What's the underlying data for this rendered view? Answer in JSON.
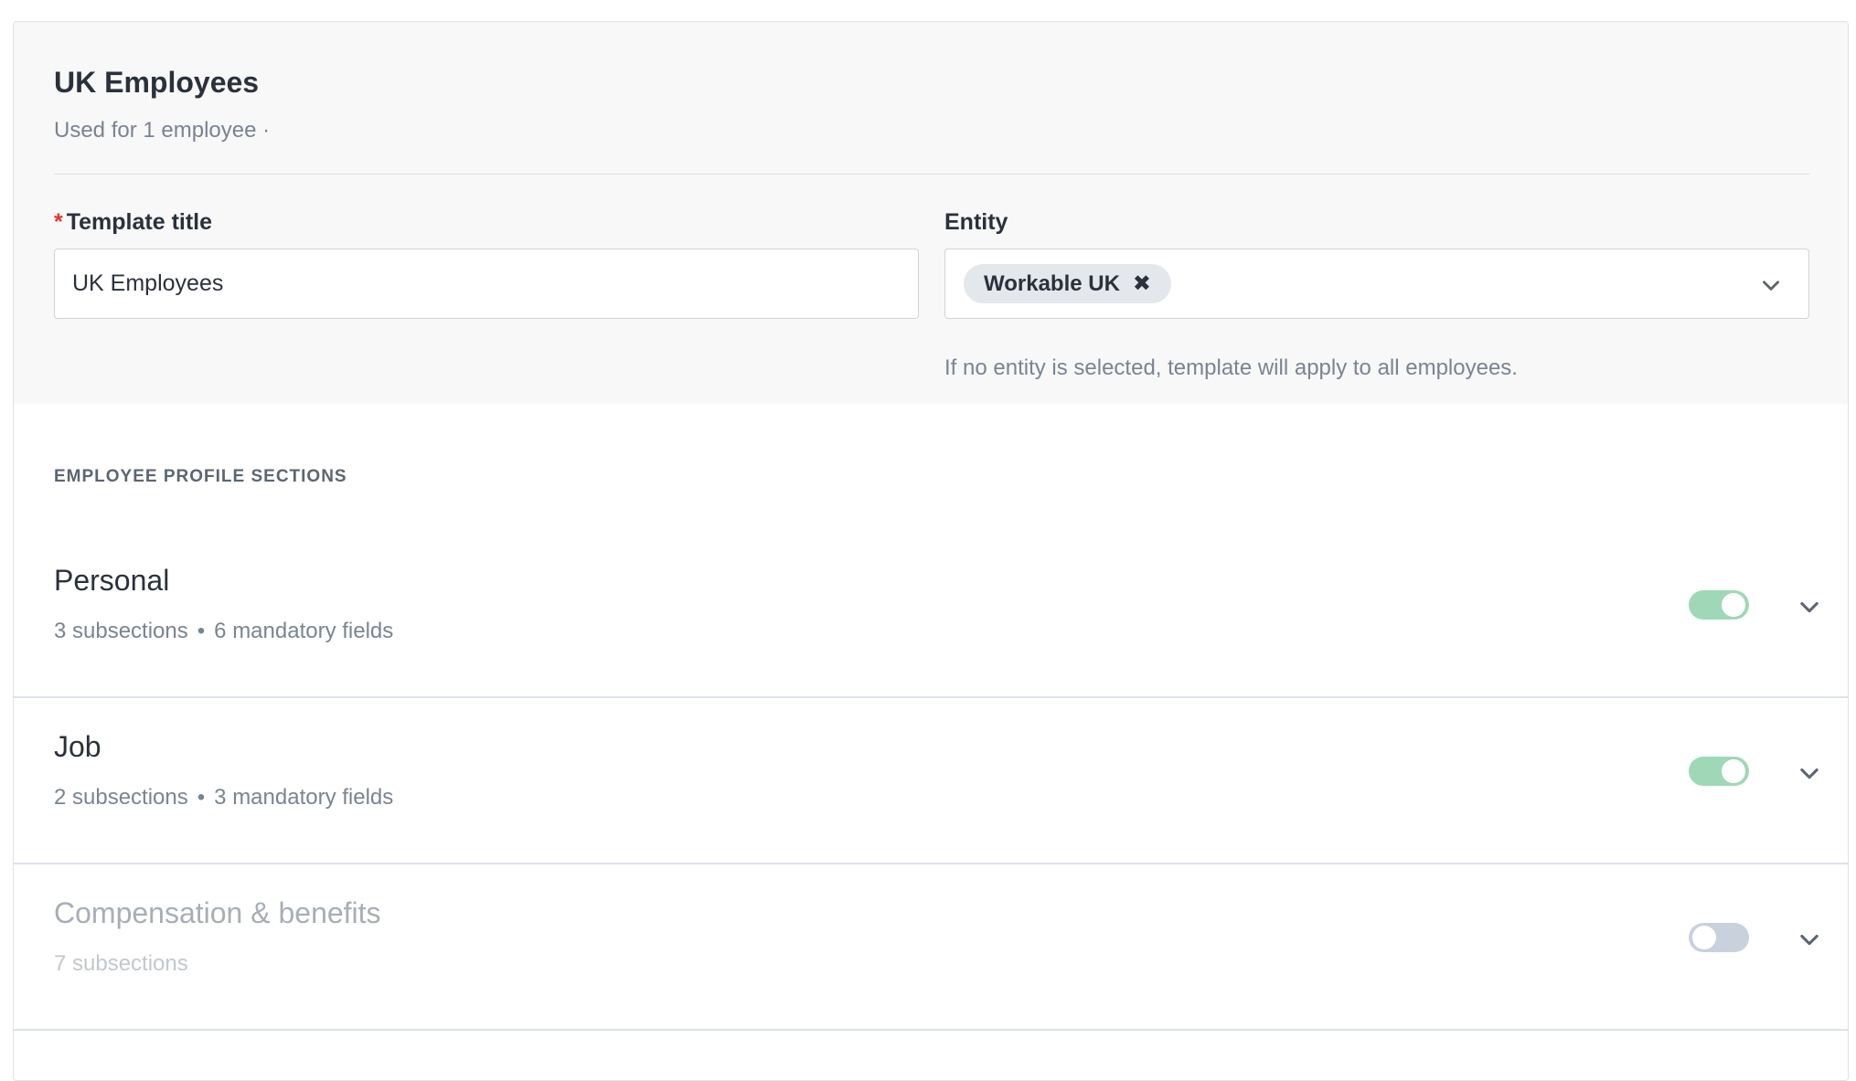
{
  "template": {
    "name": "UK Employees",
    "usage": "Used for 1 employee ·"
  },
  "form": {
    "title_required_mark": "*",
    "title_label": "Template title",
    "title_value": "UK Employees",
    "entity_label": "Entity",
    "entity_chip": "Workable UK",
    "entity_chip_remove": "✖",
    "entity_helper": "If no entity is selected, template will apply to all employees."
  },
  "sections_heading": "EMPLOYEE PROFILE SECTIONS",
  "sections": [
    {
      "title": "Personal",
      "subsections": "3 subsections",
      "separator": "•",
      "mandatory": "6 mandatory fields",
      "enabled": true
    },
    {
      "title": "Job",
      "subsections": "2 subsections",
      "separator": "•",
      "mandatory": "3 mandatory fields",
      "enabled": true
    },
    {
      "title": "Compensation & benefits",
      "subsections": "7 subsections",
      "enabled": false
    }
  ],
  "colors": {
    "toggle_on": "#9fd8b6",
    "toggle_off": "#c8d1dc",
    "required": "#e0382f"
  },
  "icons": {
    "chip_remove": "close-icon",
    "select_dropdown": "chevron-down-icon",
    "row_expand": "chevron-down-icon"
  }
}
